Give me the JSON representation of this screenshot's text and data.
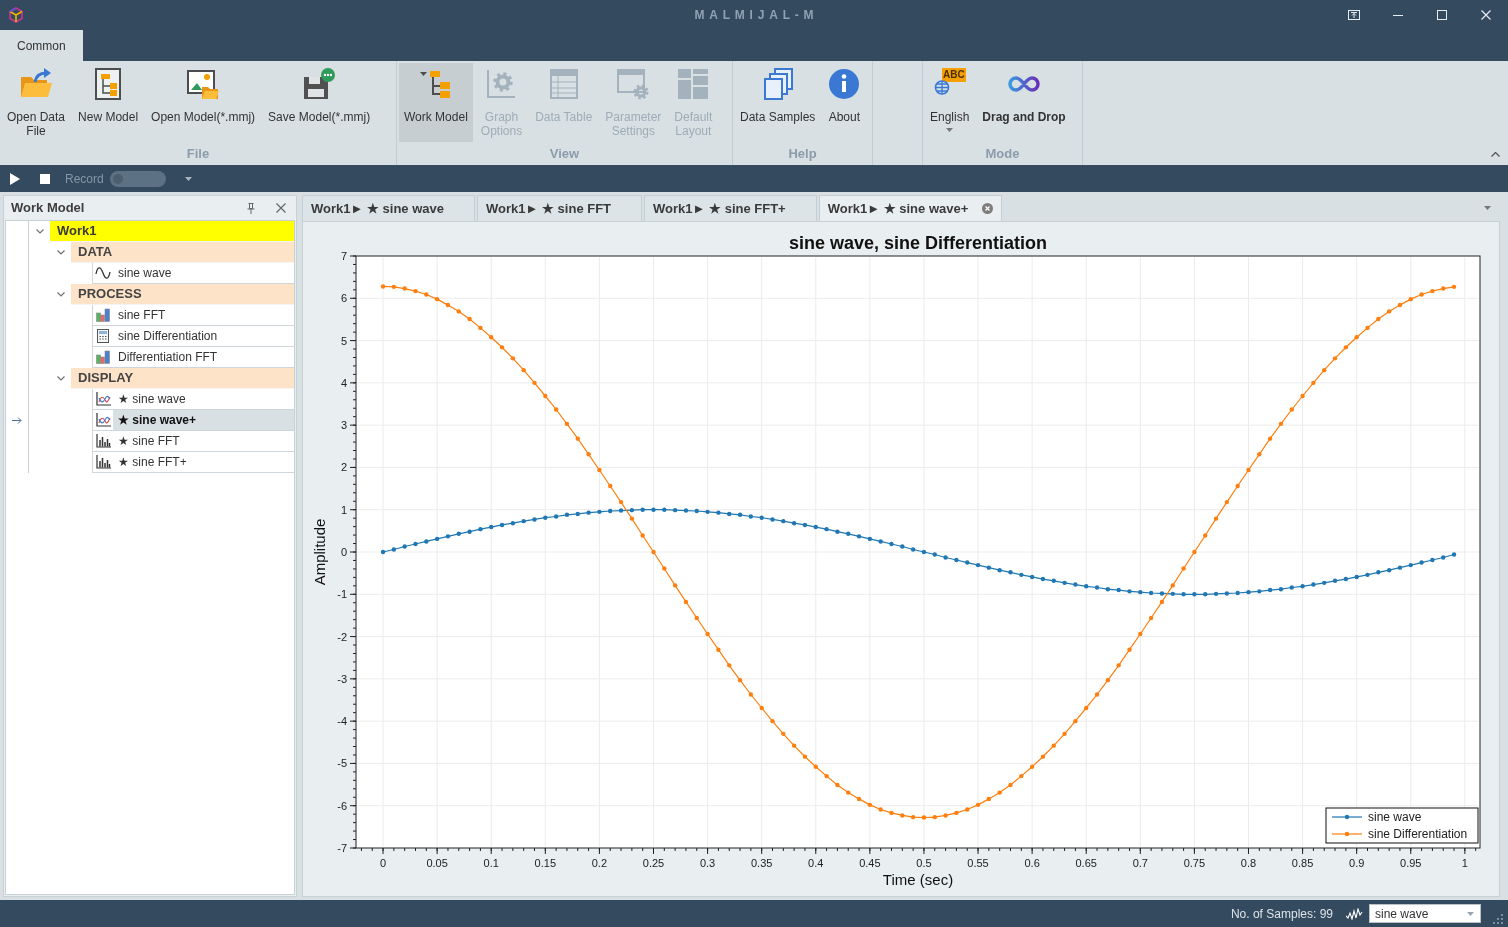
{
  "window": {
    "title": "MALMIJAL-M"
  },
  "ribbon": {
    "tabs": [
      {
        "label": "Common",
        "selected": true
      }
    ],
    "groups": [
      {
        "label": "File",
        "buttons": [
          {
            "label": "Open Data\nFile",
            "kind": "command",
            "disabled": false
          },
          {
            "label": "New Model",
            "kind": "command",
            "disabled": false
          },
          {
            "label": "Open Model(*.mmj)",
            "kind": "command",
            "disabled": false
          },
          {
            "label": "Save Model(*.mmj)",
            "kind": "command",
            "disabled": false
          }
        ]
      },
      {
        "label": "View",
        "buttons": [
          {
            "label": "Work Model",
            "kind": "toggle",
            "checked": true,
            "disabled": false
          },
          {
            "label": "Graph\nOptions",
            "kind": "command",
            "disabled": true
          },
          {
            "label": "Data Table",
            "kind": "command",
            "disabled": true
          },
          {
            "label": "Parameter\nSettings",
            "kind": "command",
            "disabled": true
          },
          {
            "label": "Default\nLayout",
            "kind": "command",
            "disabled": true
          }
        ]
      },
      {
        "label": "Help",
        "buttons": [
          {
            "label": "Data Samples",
            "kind": "command",
            "disabled": false
          },
          {
            "label": "About",
            "kind": "command",
            "disabled": false
          }
        ]
      },
      {
        "label": "Mode",
        "buttons": [
          {
            "label": "English",
            "kind": "dropdown",
            "badge": "ABC",
            "disabled": false
          },
          {
            "label": "Drag and Drop",
            "kind": "mode",
            "on": true,
            "disabled": false
          }
        ]
      }
    ]
  },
  "toolbar": {
    "record": {
      "label": "Record",
      "on": false
    }
  },
  "work_model_panel": {
    "title": "Work Model",
    "tree": [
      {
        "label": "Work1",
        "kind": "model",
        "expanded": true,
        "selected": false,
        "children": [
          {
            "label": "DATA",
            "kind": "category",
            "expanded": true,
            "selected": false,
            "children": [
              {
                "label": "sine wave",
                "kind": "signal",
                "selected": false
              }
            ]
          },
          {
            "label": "PROCESS",
            "kind": "category",
            "expanded": true,
            "selected": false,
            "children": [
              {
                "label": "sine FFT",
                "kind": "spectrum",
                "selected": false
              },
              {
                "label": "sine Differentiation",
                "kind": "calculation",
                "selected": false
              },
              {
                "label": "Differentiation FFT",
                "kind": "spectrum",
                "selected": false
              }
            ]
          },
          {
            "label": "DISPLAY",
            "kind": "category",
            "expanded": true,
            "selected": false,
            "children": [
              {
                "label": "★ sine wave",
                "kind": "plot",
                "selected": false
              },
              {
                "label": "★ sine wave+",
                "kind": "plot",
                "selected": true
              },
              {
                "label": "★ sine FFT",
                "kind": "bar-plot",
                "selected": false
              },
              {
                "label": "★ sine FFT+",
                "kind": "bar-plot",
                "selected": false
              }
            ]
          }
        ]
      }
    ]
  },
  "document_tabs": [
    {
      "label": "Work1► ★ sine wave",
      "selected": false
    },
    {
      "label": "Work1► ★ sine FFT",
      "selected": false
    },
    {
      "label": "Work1► ★ sine FFT+",
      "selected": false
    },
    {
      "label": "Work1► ★ sine wave+",
      "selected": true
    }
  ],
  "chart_panel": {
    "chart_data": {
      "type": "line",
      "title": "sine wave, sine Differentiation",
      "xlabel": "Time (sec)",
      "ylabel": "Amplitude",
      "x": [
        0,
        0.01,
        0.02,
        0.03,
        0.04,
        0.05,
        0.06,
        0.07,
        0.08,
        0.09,
        0.1,
        0.11,
        0.12,
        0.13,
        0.14,
        0.15,
        0.16,
        0.17,
        0.18,
        0.19,
        0.2,
        0.21,
        0.22,
        0.23,
        0.24,
        0.25,
        0.26,
        0.27,
        0.28,
        0.29,
        0.3,
        0.31,
        0.32,
        0.33,
        0.34,
        0.35,
        0.36,
        0.37,
        0.38,
        0.39,
        0.4,
        0.41,
        0.42,
        0.43,
        0.44,
        0.45,
        0.46,
        0.47,
        0.48,
        0.49,
        0.5,
        0.51,
        0.52,
        0.53,
        0.54,
        0.55,
        0.56,
        0.57,
        0.58,
        0.59,
        0.6,
        0.61,
        0.62,
        0.63,
        0.64,
        0.65,
        0.66,
        0.67,
        0.68,
        0.69,
        0.7,
        0.71,
        0.72,
        0.73,
        0.74,
        0.75,
        0.76,
        0.77,
        0.78,
        0.79,
        0.8,
        0.81,
        0.82,
        0.83,
        0.84,
        0.85,
        0.86,
        0.87,
        0.88,
        0.89,
        0.9,
        0.91,
        0.92,
        0.93,
        0.94,
        0.95,
        0.96,
        0.97,
        0.98,
        0.99
      ],
      "series": [
        {
          "name": "sine wave",
          "color": "#1f77b4",
          "values": [
            0,
            0.06,
            0.13,
            0.19,
            0.25,
            0.31,
            0.37,
            0.43,
            0.48,
            0.54,
            0.59,
            0.64,
            0.68,
            0.73,
            0.77,
            0.81,
            0.84,
            0.88,
            0.9,
            0.93,
            0.95,
            0.97,
            0.98,
            0.99,
            1,
            1,
            1,
            0.99,
            0.98,
            0.97,
            0.95,
            0.93,
            0.9,
            0.88,
            0.84,
            0.81,
            0.77,
            0.73,
            0.68,
            0.64,
            0.59,
            0.54,
            0.48,
            0.43,
            0.37,
            0.31,
            0.25,
            0.19,
            0.13,
            0.06,
            0,
            -0.06,
            -0.13,
            -0.19,
            -0.25,
            -0.31,
            -0.37,
            -0.43,
            -0.48,
            -0.54,
            -0.59,
            -0.64,
            -0.68,
            -0.73,
            -0.77,
            -0.81,
            -0.84,
            -0.88,
            -0.9,
            -0.93,
            -0.95,
            -0.97,
            -0.98,
            -0.99,
            -1,
            -1,
            -1,
            -0.99,
            -0.98,
            -0.97,
            -0.95,
            -0.93,
            -0.9,
            -0.88,
            -0.84,
            -0.81,
            -0.77,
            -0.73,
            -0.68,
            -0.64,
            -0.59,
            -0.54,
            -0.48,
            -0.43,
            -0.37,
            -0.31,
            -0.25,
            -0.19,
            -0.13,
            -0.06
          ]
        },
        {
          "name": "sine Differentiation",
          "color": "#ff7f0e",
          "values": [
            6.28,
            6.27,
            6.23,
            6.17,
            6.09,
            5.98,
            5.84,
            5.69,
            5.51,
            5.3,
            5.08,
            4.84,
            4.58,
            4.3,
            4,
            3.69,
            3.37,
            3.03,
            2.68,
            2.31,
            1.94,
            1.56,
            1.18,
            0.79,
            0.39,
            0,
            -0.39,
            -0.79,
            -1.18,
            -1.56,
            -1.94,
            -2.31,
            -2.68,
            -3.03,
            -3.37,
            -3.69,
            -4,
            -4.3,
            -4.58,
            -4.84,
            -5.08,
            -5.3,
            -5.51,
            -5.69,
            -5.84,
            -5.98,
            -6.09,
            -6.17,
            -6.23,
            -6.27,
            -6.28,
            -6.27,
            -6.23,
            -6.17,
            -6.09,
            -5.98,
            -5.84,
            -5.69,
            -5.51,
            -5.3,
            -5.08,
            -4.84,
            -4.58,
            -4.3,
            -4,
            -3.69,
            -3.37,
            -3.03,
            -2.68,
            -2.31,
            -1.94,
            -1.56,
            -1.18,
            -0.79,
            -0.39,
            0,
            0.39,
            0.79,
            1.18,
            1.56,
            1.94,
            2.31,
            2.68,
            3.03,
            3.37,
            3.69,
            4,
            4.3,
            4.58,
            4.84,
            5.08,
            5.3,
            5.51,
            5.69,
            5.84,
            5.98,
            6.09,
            6.17,
            6.23,
            6.27
          ]
        }
      ],
      "xlim": [
        -0.025,
        1.014
      ],
      "ylim": [
        -7,
        7
      ],
      "xticks": [
        0,
        0.05,
        0.1,
        0.15,
        0.2,
        0.25,
        0.3,
        0.35,
        0.4,
        0.45,
        0.5,
        0.55,
        0.6,
        0.65,
        0.7,
        0.75,
        0.8,
        0.85,
        0.9,
        0.95,
        1
      ],
      "yticks": [
        -7,
        -6,
        -5,
        -4,
        -3,
        -2,
        -1,
        0,
        1,
        2,
        3,
        4,
        5,
        6,
        7
      ],
      "grid": true,
      "legend": "lower right"
    }
  },
  "status_bar": {
    "sample_count": "No. of Samples: 99",
    "series_select": {
      "value": "sine wave"
    }
  }
}
